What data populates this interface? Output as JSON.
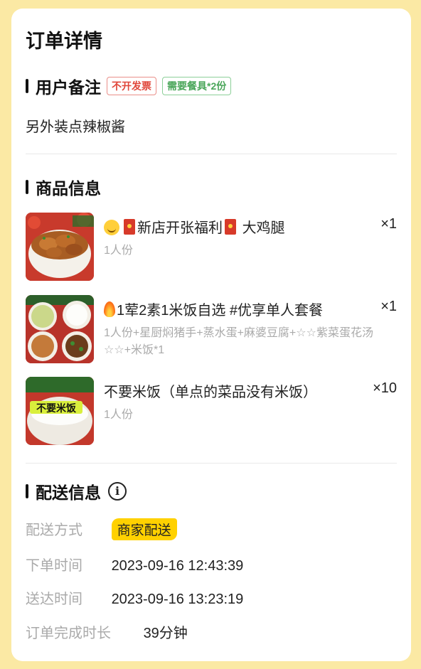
{
  "page": {
    "title": "订单详情"
  },
  "remark_section": {
    "title": "用户备注",
    "tags": [
      "不开发票",
      "需要餐具*2份"
    ],
    "text": "另外装点辣椒酱"
  },
  "goods_section": {
    "title": "商品信息",
    "items": [
      {
        "name": "新店开张福利",
        "name_suffix": "大鸡腿",
        "qty": "×1",
        "spec": "1人份",
        "thumb": "drumstick-bowl"
      },
      {
        "name": "1荤2素1米饭自选 #优享单人套餐",
        "qty": "×1",
        "spec": "1人份+星厨焖猪手+蒸水蛋+麻婆豆腐+☆☆紫菜蛋花汤☆☆+米饭*1",
        "thumb": "set-meal"
      },
      {
        "name": "不要米饭（单点的菜品没有米饭）",
        "qty": "×10",
        "spec": "1人份",
        "thumb": "rice-bowl",
        "thumb_label": "不要米饭"
      }
    ]
  },
  "delivery_section": {
    "title": "配送信息",
    "icon": "info-icon",
    "rows": [
      {
        "label": "配送方式",
        "value": "商家配送"
      },
      {
        "label": "下单时间",
        "value": "2023-09-16 12:43:39"
      },
      {
        "label": "送达时间",
        "value": "2023-09-16 13:23:19"
      },
      {
        "label": "订单完成时长",
        "value": "39分钟"
      }
    ]
  },
  "colors": {
    "background": "#fbe9a4",
    "accent_yellow": "#ffd100",
    "tag_red": "#e0463a",
    "tag_green": "#4aa65a"
  }
}
